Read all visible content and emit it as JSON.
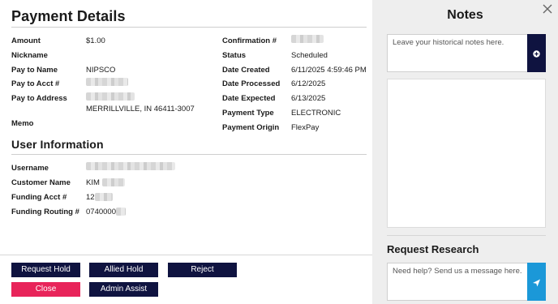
{
  "payment": {
    "title": "Payment Details",
    "left_fields": [
      {
        "label": "Amount",
        "value": "$1.00"
      },
      {
        "label": "Nickname",
        "value": ""
      },
      {
        "label": "Pay to Name",
        "value": "NIPSCO"
      },
      {
        "label": "Pay to Acct #",
        "value": ""
      },
      {
        "label": "Pay to Address",
        "value": ""
      },
      {
        "label": "Memo",
        "value": ""
      }
    ],
    "address_line2": "MERRILLVILLE, IN 46411-3007",
    "right_fields": [
      {
        "label": "Confirmation #",
        "value": ""
      },
      {
        "label": "Status",
        "value": "Scheduled"
      },
      {
        "label": "Date Created",
        "value": "6/11/2025 4:59:46 PM"
      },
      {
        "label": "Date Processed",
        "value": "6/12/2025"
      },
      {
        "label": "Date Expected",
        "value": "6/13/2025"
      },
      {
        "label": "Payment Type",
        "value": "ELECTRONIC"
      },
      {
        "label": "Payment Origin",
        "value": "FlexPay"
      }
    ]
  },
  "user": {
    "title": "User Information",
    "fields": [
      {
        "label": "Username",
        "value": ""
      },
      {
        "label": "Customer Name",
        "value": "KIM"
      },
      {
        "label": "Funding Acct #",
        "value": "12"
      },
      {
        "label": "Funding Routing #",
        "value": "0740000"
      }
    ]
  },
  "buttons": {
    "request_hold": "Request Hold",
    "allied_hold": "Allied Hold",
    "reject": "Reject",
    "close": "Close",
    "admin_assist": "Admin Assist"
  },
  "notes": {
    "title": "Notes",
    "placeholder": "Leave your historical notes here.",
    "add_icon": "plus-circle-icon",
    "close_icon": "close-icon"
  },
  "research": {
    "title": "Request Research",
    "placeholder": "Need help? Send us a message here.",
    "send_icon": "send-icon"
  },
  "colors": {
    "navy": "#0f1340",
    "red": "#e8245a",
    "send_blue": "#1b98d8",
    "panel_gray": "#eeeeee"
  }
}
